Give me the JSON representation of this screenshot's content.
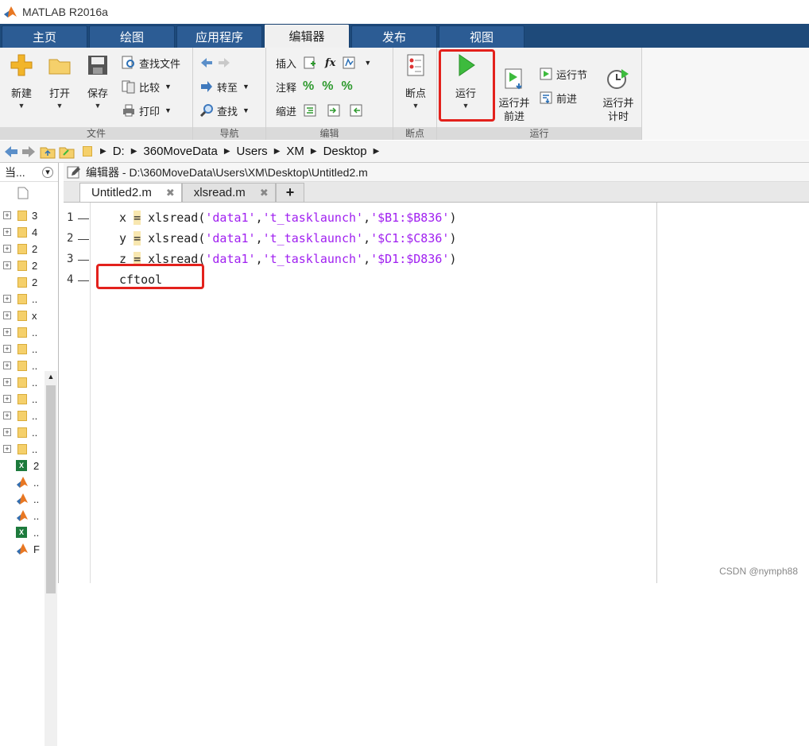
{
  "window": {
    "title": "MATLAB R2016a"
  },
  "tabs": [
    "主页",
    "绘图",
    "应用程序",
    "编辑器",
    "发布",
    "视图"
  ],
  "ribbon": {
    "file": {
      "label": "文件",
      "new": "新建",
      "open": "打开",
      "save": "保存",
      "find_files": "查找文件",
      "compare": "比较",
      "print": "打印"
    },
    "nav": {
      "label": "导航",
      "goto": "转至",
      "find": "查找"
    },
    "edit": {
      "label": "编辑",
      "insert": "插入",
      "comment": "注释",
      "indent": "缩进",
      "fx": "fx"
    },
    "breakpoints": {
      "label": "断点",
      "btn": "断点"
    },
    "run": {
      "label": "运行",
      "run": "运行",
      "run_advance": "运行并\n前进",
      "run_section": "运行节",
      "advance": "前进",
      "run_time": "运行并\n计时"
    }
  },
  "address": {
    "crumbs": [
      "D:",
      "360MoveData",
      "Users",
      "XM",
      "Desktop"
    ]
  },
  "current_folder": {
    "header": "当...",
    "rows": [
      "3",
      "4",
      "2",
      "2",
      "2",
      "..",
      "x",
      "..",
      "..",
      "..",
      "..",
      "..",
      "..",
      "..",
      "..",
      "2",
      "..",
      "..",
      "..",
      "..",
      "F"
    ]
  },
  "editor": {
    "title": "编辑器 - D:\\360MoveData\\Users\\XM\\Desktop\\Untitled2.m",
    "tabs": [
      "Untitled2.m",
      "xlsread.m"
    ],
    "lines": [
      {
        "n": "1",
        "pre": "x ",
        "op": "=",
        "mid": " xlsread(",
        "s1": "'data1'",
        "c1": ",",
        "s2": "'t_tasklaunch'",
        "c2": ",",
        "s3": "'$B1:$B836'",
        "end": ")"
      },
      {
        "n": "2",
        "pre": "y ",
        "op": "=",
        "mid": " xlsread(",
        "s1": "'data1'",
        "c1": ",",
        "s2": "'t_tasklaunch'",
        "c2": ",",
        "s3": "'$C1:$C836'",
        "end": ")"
      },
      {
        "n": "3",
        "pre": "z ",
        "op": "=",
        "mid": " xlsread(",
        "s1": "'data1'",
        "c1": ",",
        "s2": "'t_tasklaunch'",
        "c2": ",",
        "s3": "'$D1:$D836'",
        "end": ")"
      },
      {
        "n": "4",
        "text": "cftool"
      }
    ]
  },
  "watermark": "CSDN @nymph88"
}
